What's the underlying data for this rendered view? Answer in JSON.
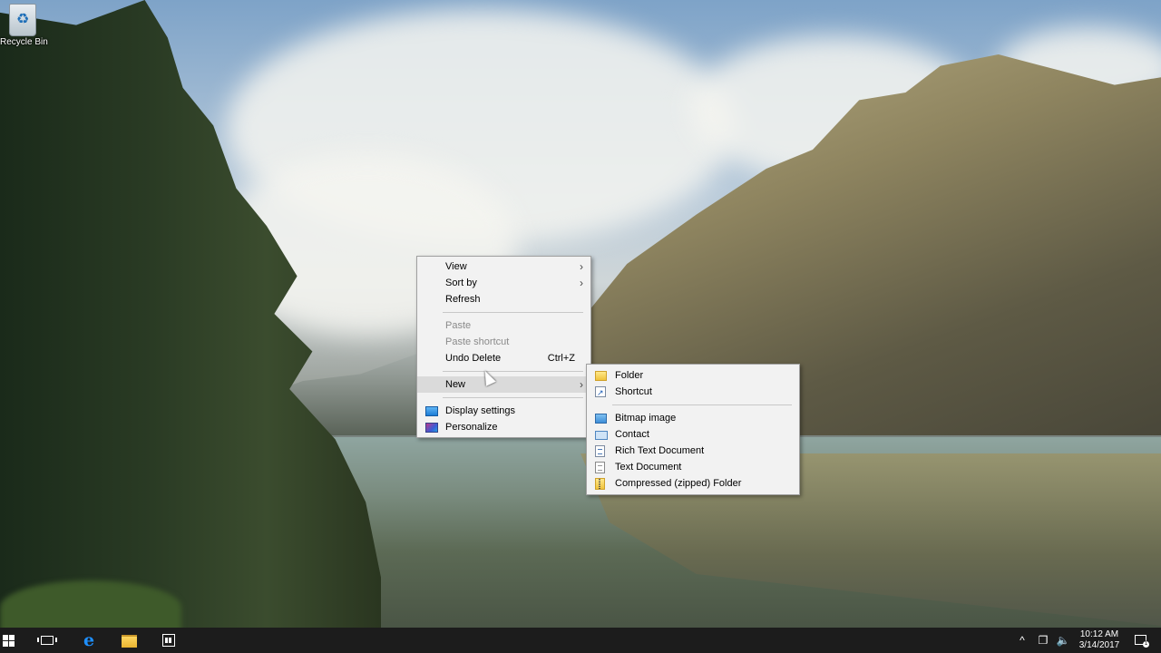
{
  "desktop": {
    "recycle_bin_label": "Recycle Bin"
  },
  "context_menu": {
    "items": [
      {
        "label": "View",
        "has_submenu": true
      },
      {
        "label": "Sort by",
        "has_submenu": true
      },
      {
        "label": "Refresh"
      },
      {
        "label": "Paste",
        "disabled": true
      },
      {
        "label": "Paste shortcut",
        "disabled": true
      },
      {
        "label": "Undo Delete",
        "shortcut": "Ctrl+Z"
      },
      {
        "label": "New",
        "has_submenu": true,
        "highlighted": true
      },
      {
        "label": "Display settings",
        "icon": "display-icon"
      },
      {
        "label": "Personalize",
        "icon": "personalize-icon"
      }
    ]
  },
  "new_submenu": {
    "items": [
      {
        "label": "Folder",
        "icon": "folder-icon"
      },
      {
        "label": "Shortcut",
        "icon": "shortcut-icon"
      },
      {
        "label": "Bitmap image",
        "icon": "bitmap-icon"
      },
      {
        "label": "Contact",
        "icon": "contact-icon"
      },
      {
        "label": "Rich Text Document",
        "icon": "rich-text-icon"
      },
      {
        "label": "Text Document",
        "icon": "text-document-icon"
      },
      {
        "label": "Compressed (zipped) Folder",
        "icon": "zip-folder-icon"
      }
    ]
  },
  "taskbar": {
    "edge_glyph": "e",
    "tray_chevron": "^",
    "tray_network": "❐",
    "tray_volume": "🔈",
    "clock_time": "10:12 AM",
    "clock_date": "3/14/2017",
    "notification_badge": "1"
  },
  "colors": {
    "taskbar_bg": "#1c1c1c",
    "menu_bg": "#f2f2f2",
    "menu_hover": "#dadada",
    "disabled_text": "#8a8a8a"
  }
}
